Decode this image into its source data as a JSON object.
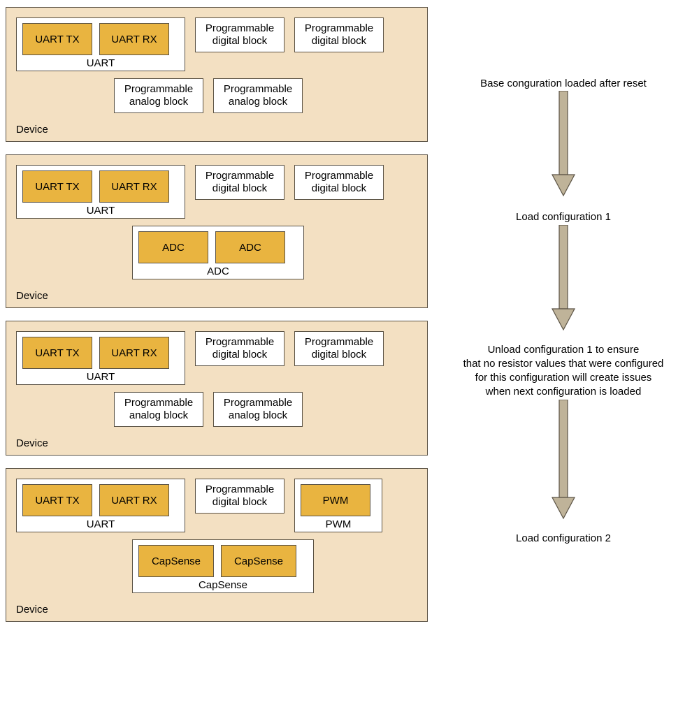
{
  "devices": [
    {
      "label": "Device",
      "uart": {
        "tx": "UART TX",
        "rx": "UART RX",
        "label": "UART"
      },
      "row1_blocks": [
        "Programmable\ndigital block",
        "Programmable\ndigital block"
      ],
      "row2_blocks": [
        "Programmable\nanalog block",
        "Programmable\nanalog block"
      ],
      "row2_group": null
    },
    {
      "label": "Device",
      "uart": {
        "tx": "UART TX",
        "rx": "UART RX",
        "label": "UART"
      },
      "row1_blocks": [
        "Programmable\ndigital block",
        "Programmable\ndigital block"
      ],
      "row2_blocks": null,
      "row2_group": {
        "items": [
          "ADC",
          "ADC"
        ],
        "label": "ADC"
      }
    },
    {
      "label": "Device",
      "uart": {
        "tx": "UART TX",
        "rx": "UART RX",
        "label": "UART"
      },
      "row1_blocks": [
        "Programmable\ndigital block",
        "Programmable\ndigital block"
      ],
      "row2_blocks": [
        "Programmable\nanalog block",
        "Programmable\nanalog block"
      ],
      "row2_group": null
    },
    {
      "label": "Device",
      "uart": {
        "tx": "UART TX",
        "rx": "UART RX",
        "label": "UART"
      },
      "row1_blocks": [
        "Programmable\ndigital block"
      ],
      "row1_group": {
        "items": [
          "PWM"
        ],
        "label": "PWM"
      },
      "row2_blocks": null,
      "row2_group": {
        "items": [
          "CapSense",
          "CapSense"
        ],
        "label": "CapSense"
      }
    }
  ],
  "flow": {
    "step0": "Base conguration loaded after reset",
    "step1": "Load configuration 1",
    "step2_l1": "Unload configuration 1 to ensure",
    "step2_l2": "that no resistor values that were configured",
    "step2_l3": "for this configuration will create issues",
    "step2_l4": "when next configuration is loaded",
    "step3": "Load configuration 2"
  }
}
